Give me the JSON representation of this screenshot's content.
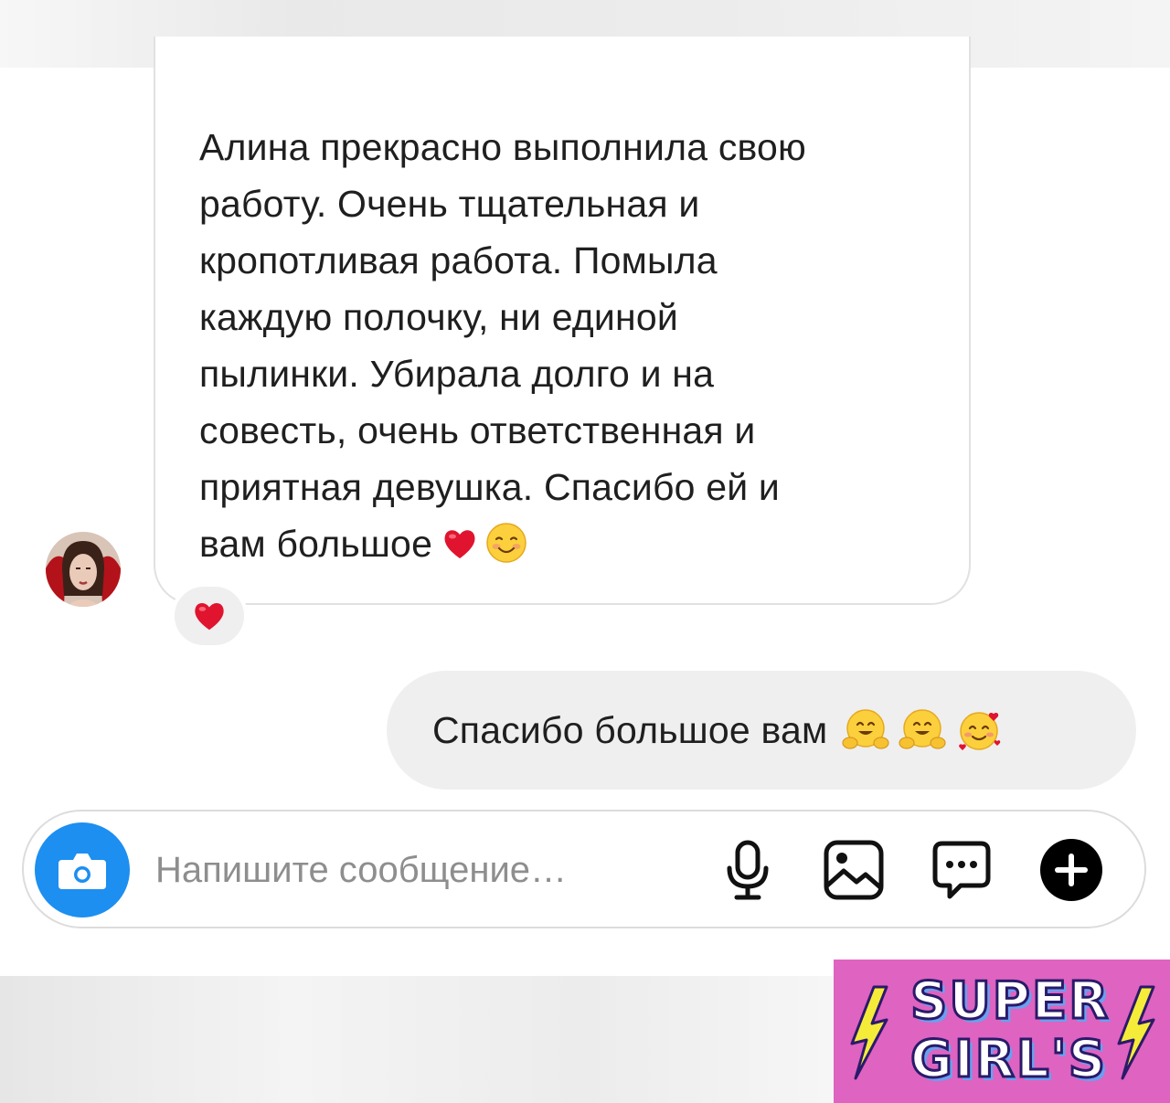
{
  "incoming_message": {
    "text": "Алина прекрасно выполнила свою\nработу. Очень тщательная и\nкропотливая работа. Помыла\nкаждую полочку, ни единой\nпылинки. Убирала долго и на\nсовесть, очень ответственная и\nприятная девушка. Спасибо ей и\nвам большое",
    "emojis": [
      "red-heart",
      "smiling-face"
    ],
    "reaction": "red-heart"
  },
  "outgoing_message": {
    "text": "Спасибо большое вам",
    "emojis": [
      "hugging-face",
      "hugging-face",
      "smiling-face-with-hearts"
    ]
  },
  "composer": {
    "placeholder": "Напишите сообщение…"
  },
  "logo": {
    "line1": "SUPER",
    "line2": "GIRL'S"
  },
  "colors": {
    "accent_blue": "#1c8ff0",
    "bubble_gray": "#efefef",
    "logo_pink": "#df63c0",
    "heart_red": "#e0142e"
  }
}
